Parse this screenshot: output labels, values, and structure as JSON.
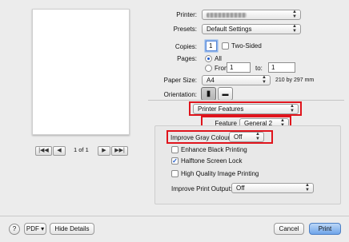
{
  "preview": {
    "first_label": "|◀◀",
    "prev_label": "◀",
    "page_indicator": "1 of 1",
    "next_label": "▶",
    "last_label": "▶▶|"
  },
  "printer": {
    "label": "Printer:"
  },
  "presets": {
    "label": "Presets:",
    "value": "Default Settings"
  },
  "copies": {
    "label": "Copies:",
    "value": "1",
    "two_sided_label": "Two-Sided",
    "two_sided_checked": false
  },
  "pages": {
    "label": "Pages:",
    "all_label": "All",
    "from_label": "From:",
    "from_value": "1",
    "to_label": "to:",
    "to_value": "1",
    "selected": "All"
  },
  "paper_size": {
    "label": "Paper Size:",
    "value": "A4",
    "dimensions": "210 by 297 mm"
  },
  "orientation": {
    "label": "Orientation:",
    "selected": "portrait"
  },
  "section": {
    "value": "Printer Features"
  },
  "feature_sets": {
    "label": "Feature Sets:",
    "value": "General 2"
  },
  "improve_gray": {
    "label": "Improve Gray Colour:",
    "value": "Off"
  },
  "options": [
    {
      "label": "Enhance Black Printing",
      "checked": false
    },
    {
      "label": "Halftone Screen Lock",
      "checked": true
    },
    {
      "label": "High Quality Image Printing",
      "checked": false
    }
  ],
  "improve_print_output": {
    "label": "Improve Print Output:",
    "value": "Off"
  },
  "footer": {
    "help_label": "?",
    "pdf_label": "PDF ▾",
    "hide_details_label": "Hide Details",
    "cancel_label": "Cancel",
    "print_label": "Print"
  },
  "colors": {
    "highlight": "#e0141c",
    "accent": "#1a56c9"
  }
}
